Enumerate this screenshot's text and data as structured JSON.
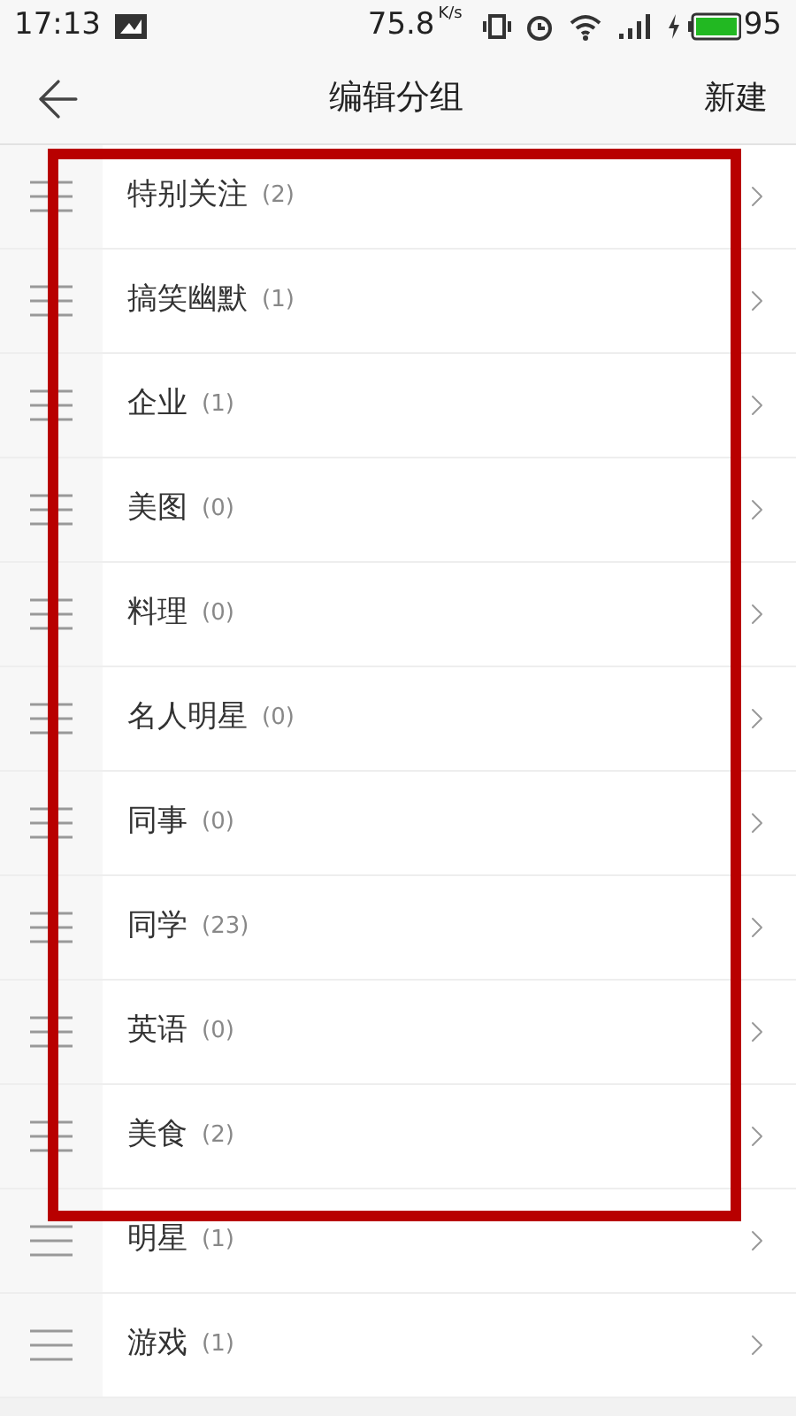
{
  "status_bar": {
    "time": "17:13",
    "speed": "75.8",
    "speed_unit": "K/s",
    "battery": "95"
  },
  "header": {
    "title": "编辑分组",
    "action": "新建"
  },
  "groups": [
    {
      "name": "特别关注",
      "count": "(2)"
    },
    {
      "name": "搞笑幽默",
      "count": "(1)"
    },
    {
      "name": "企业",
      "count": "(1)"
    },
    {
      "name": "美图",
      "count": "(0)"
    },
    {
      "name": "料理",
      "count": "(0)"
    },
    {
      "name": "名人明星",
      "count": "(0)"
    },
    {
      "name": "同事",
      "count": "(0)"
    },
    {
      "name": "同学",
      "count": "(23)"
    },
    {
      "name": "英语",
      "count": "(0)"
    },
    {
      "name": "美食",
      "count": "(2)"
    },
    {
      "name": "明星",
      "count": "(1)"
    },
    {
      "name": "游戏",
      "count": "(1)"
    }
  ],
  "highlight": {
    "color": "#b80000"
  }
}
